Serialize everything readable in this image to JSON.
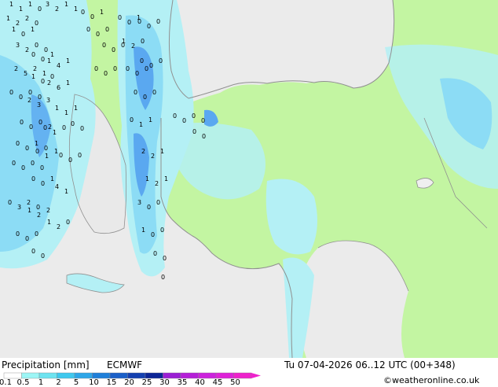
{
  "footer": {
    "title": "Precipitation [mm]",
    "model": "ECMWF",
    "valid_time": "Tu 07-04-2026 06..12 UTC (00+348)",
    "credit": "©weatheronline.co.uk"
  },
  "legend": {
    "ticks": [
      "0.1",
      "0.5",
      "1",
      "2",
      "5",
      "10",
      "15",
      "20",
      "25",
      "30",
      "35",
      "40",
      "45",
      "50"
    ],
    "colors": [
      "#ffffff",
      "#9cf5f5",
      "#6de3f0",
      "#3fc8ee",
      "#2ea6e8",
      "#1f7fd9",
      "#1a5fc8",
      "#1440b0",
      "#0c2596",
      "#9b1fd4",
      "#b51fd8",
      "#cc22dd",
      "#de22d8",
      "#ee22cc"
    ]
  },
  "colors": {
    "sea": "#ebebeb",
    "land_dry": "#efefef",
    "land_forecast": "#c3f5a2",
    "precip_light": "#b4f0f5",
    "precip_medium": "#8cdcf5",
    "precip_heavy": "#5aa8f0",
    "coast": "#909090"
  },
  "map_labels": [
    "1",
    "1",
    "1",
    "0",
    "3",
    "2",
    "1",
    "1",
    "0",
    "0",
    "1",
    "1",
    "2",
    "2",
    "0",
    "1",
    "0",
    "1",
    "3",
    "2",
    "0",
    "0",
    "0",
    "0",
    "1",
    "1",
    "4",
    "1",
    "2",
    "5",
    "2",
    "1",
    "1",
    "0",
    "0",
    "2",
    "6",
    "1",
    "0",
    "0",
    "0",
    "0",
    "2",
    "3",
    "3",
    "1",
    "1",
    "1",
    "0",
    "0",
    "0",
    "2",
    "0",
    "1",
    "0",
    "0",
    "0",
    "0",
    "0",
    "1",
    "0",
    "0",
    "1",
    "1",
    "0",
    "0",
    "0",
    "0",
    "0",
    "0",
    "0",
    "0",
    "0",
    "1",
    "4",
    "1",
    "0",
    "3",
    "2",
    "0",
    "1",
    "2",
    "2",
    "1",
    "2",
    "0",
    "0",
    "0",
    "0",
    "0",
    "0",
    "0",
    "0",
    "0",
    "0",
    "0",
    "0",
    "0",
    "0",
    "0",
    "0",
    "0",
    "1",
    "1",
    "2",
    "0",
    "0",
    "0",
    "0",
    "0",
    "0",
    "0",
    "0",
    "0",
    "0",
    "0",
    "0",
    "0",
    "0",
    "1",
    "1",
    "2",
    "2",
    "1",
    "1",
    "2",
    "1",
    "3",
    "0",
    "0",
    "1",
    "0",
    "0",
    "0",
    "0",
    "0",
    "0",
    "0",
    "0",
    "0",
    "0",
    "0"
  ]
}
